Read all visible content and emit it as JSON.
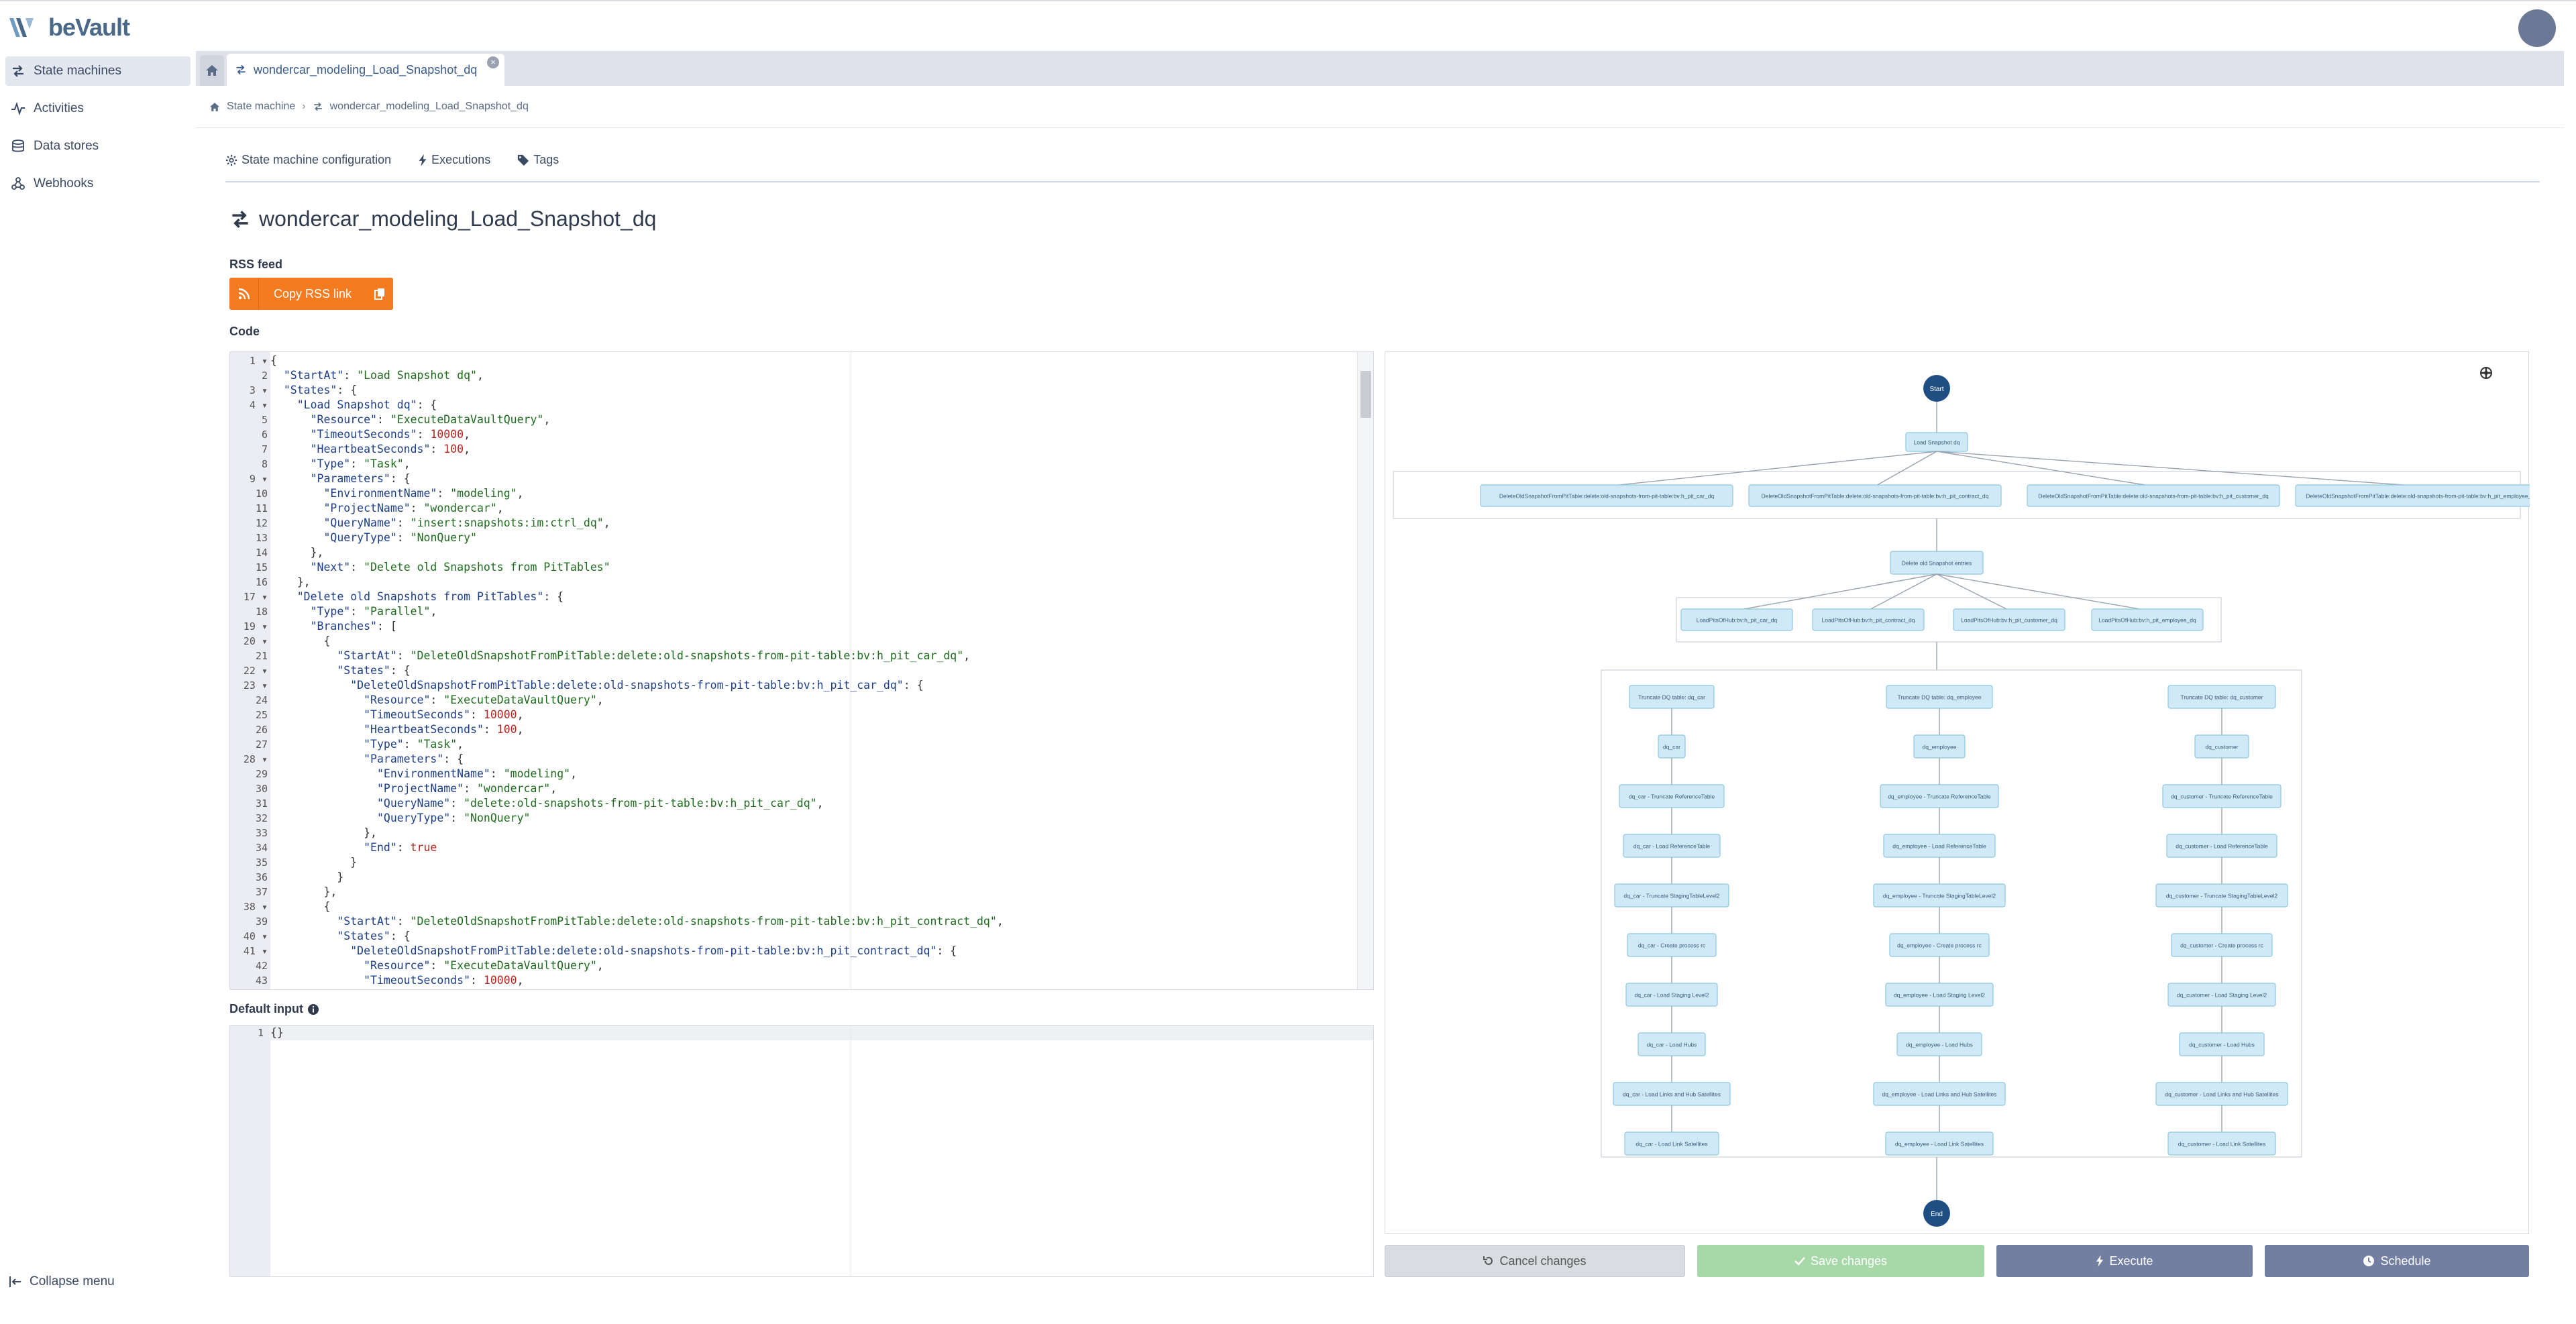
{
  "app": {
    "name": "beVault"
  },
  "sidebar": {
    "items": [
      {
        "label": "State machines",
        "icon": "exchange-icon",
        "active": true
      },
      {
        "label": "Activities",
        "icon": "activity-icon"
      },
      {
        "label": "Data stores",
        "icon": "database-icon"
      },
      {
        "label": "Webhooks",
        "icon": "webhook-icon"
      }
    ],
    "collapse_label": "Collapse menu"
  },
  "tabs": {
    "doc_tab_label": "wondercar_modeling_Load_Snapshot_dq"
  },
  "breadcrumb": {
    "root": "State machine",
    "current": "wondercar_modeling_Load_Snapshot_dq"
  },
  "page_tabs": {
    "config": "State machine configuration",
    "executions": "Executions",
    "tags": "Tags"
  },
  "page_title": "wondercar_modeling_Load_Snapshot_dq",
  "rss": {
    "label": "RSS feed",
    "button": "Copy RSS link"
  },
  "code_label": "Code",
  "default_input_label": "Default input",
  "default_input_value": "{}",
  "code_lines": [
    {
      "n": "1",
      "f": true,
      "t": [
        [
          "p",
          "{"
        ]
      ]
    },
    {
      "n": "2",
      "t": [
        [
          "p",
          "  "
        ],
        [
          "k",
          "\"StartAt\""
        ],
        [
          "p",
          ": "
        ],
        [
          "s",
          "\"Load Snapshot dq\""
        ],
        [
          "p",
          ","
        ]
      ]
    },
    {
      "n": "3",
      "f": true,
      "t": [
        [
          "p",
          "  "
        ],
        [
          "k",
          "\"States\""
        ],
        [
          "p",
          ": {"
        ]
      ]
    },
    {
      "n": "4",
      "f": true,
      "t": [
        [
          "p",
          "    "
        ],
        [
          "k",
          "\"Load Snapshot dq\""
        ],
        [
          "p",
          ": {"
        ]
      ]
    },
    {
      "n": "5",
      "t": [
        [
          "p",
          "      "
        ],
        [
          "k",
          "\"Resource\""
        ],
        [
          "p",
          ": "
        ],
        [
          "s",
          "\"ExecuteDataVaultQuery\""
        ],
        [
          "p",
          ","
        ]
      ]
    },
    {
      "n": "6",
      "t": [
        [
          "p",
          "      "
        ],
        [
          "k",
          "\"TimeoutSeconds\""
        ],
        [
          "p",
          ": "
        ],
        [
          "n",
          "10000"
        ],
        [
          "p",
          ","
        ]
      ]
    },
    {
      "n": "7",
      "t": [
        [
          "p",
          "      "
        ],
        [
          "k",
          "\"HeartbeatSeconds\""
        ],
        [
          "p",
          ": "
        ],
        [
          "n",
          "100"
        ],
        [
          "p",
          ","
        ]
      ]
    },
    {
      "n": "8",
      "t": [
        [
          "p",
          "      "
        ],
        [
          "k",
          "\"Type\""
        ],
        [
          "p",
          ": "
        ],
        [
          "s",
          "\"Task\""
        ],
        [
          "p",
          ","
        ]
      ]
    },
    {
      "n": "9",
      "f": true,
      "t": [
        [
          "p",
          "      "
        ],
        [
          "k",
          "\"Parameters\""
        ],
        [
          "p",
          ": {"
        ]
      ]
    },
    {
      "n": "10",
      "t": [
        [
          "p",
          "        "
        ],
        [
          "k",
          "\"EnvironmentName\""
        ],
        [
          "p",
          ": "
        ],
        [
          "s",
          "\"modeling\""
        ],
        [
          "p",
          ","
        ]
      ]
    },
    {
      "n": "11",
      "t": [
        [
          "p",
          "        "
        ],
        [
          "k",
          "\"ProjectName\""
        ],
        [
          "p",
          ": "
        ],
        [
          "s",
          "\"wondercar\""
        ],
        [
          "p",
          ","
        ]
      ]
    },
    {
      "n": "12",
      "t": [
        [
          "p",
          "        "
        ],
        [
          "k",
          "\"QueryName\""
        ],
        [
          "p",
          ": "
        ],
        [
          "s",
          "\"insert:snapshots:im:ctrl_dq\""
        ],
        [
          "p",
          ","
        ]
      ]
    },
    {
      "n": "13",
      "t": [
        [
          "p",
          "        "
        ],
        [
          "k",
          "\"QueryType\""
        ],
        [
          "p",
          ": "
        ],
        [
          "s",
          "\"NonQuery\""
        ]
      ]
    },
    {
      "n": "14",
      "t": [
        [
          "p",
          "      },"
        ]
      ]
    },
    {
      "n": "15",
      "t": [
        [
          "p",
          "      "
        ],
        [
          "k",
          "\"Next\""
        ],
        [
          "p",
          ": "
        ],
        [
          "s",
          "\"Delete old Snapshots from PitTables\""
        ]
      ]
    },
    {
      "n": "16",
      "t": [
        [
          "p",
          "    },"
        ]
      ]
    },
    {
      "n": "17",
      "f": true,
      "t": [
        [
          "p",
          "    "
        ],
        [
          "k",
          "\"Delete old Snapshots from PitTables\""
        ],
        [
          "p",
          ": {"
        ]
      ]
    },
    {
      "n": "18",
      "t": [
        [
          "p",
          "      "
        ],
        [
          "k",
          "\"Type\""
        ],
        [
          "p",
          ": "
        ],
        [
          "s",
          "\"Parallel\""
        ],
        [
          "p",
          ","
        ]
      ]
    },
    {
      "n": "19",
      "f": true,
      "t": [
        [
          "p",
          "      "
        ],
        [
          "k",
          "\"Branches\""
        ],
        [
          "p",
          ": ["
        ]
      ]
    },
    {
      "n": "20",
      "f": true,
      "t": [
        [
          "p",
          "        {"
        ]
      ]
    },
    {
      "n": "21",
      "t": [
        [
          "p",
          "          "
        ],
        [
          "k",
          "\"StartAt\""
        ],
        [
          "p",
          ": "
        ],
        [
          "s",
          "\"DeleteOldSnapshotFromPitTable:delete:old-snapshots-from-pit-table:bv:h_pit_car_dq\""
        ],
        [
          "p",
          ","
        ]
      ]
    },
    {
      "n": "22",
      "f": true,
      "t": [
        [
          "p",
          "          "
        ],
        [
          "k",
          "\"States\""
        ],
        [
          "p",
          ": {"
        ]
      ]
    },
    {
      "n": "23",
      "f": true,
      "t": [
        [
          "p",
          "            "
        ],
        [
          "k",
          "\"DeleteOldSnapshotFromPitTable:delete:old-snapshots-from-pit-table:bv:h_pit_car_dq\""
        ],
        [
          "p",
          ": {"
        ]
      ]
    },
    {
      "n": "24",
      "t": [
        [
          "p",
          "              "
        ],
        [
          "k",
          "\"Resource\""
        ],
        [
          "p",
          ": "
        ],
        [
          "s",
          "\"ExecuteDataVaultQuery\""
        ],
        [
          "p",
          ","
        ]
      ]
    },
    {
      "n": "25",
      "t": [
        [
          "p",
          "              "
        ],
        [
          "k",
          "\"TimeoutSeconds\""
        ],
        [
          "p",
          ": "
        ],
        [
          "n",
          "10000"
        ],
        [
          "p",
          ","
        ]
      ]
    },
    {
      "n": "26",
      "t": [
        [
          "p",
          "              "
        ],
        [
          "k",
          "\"HeartbeatSeconds\""
        ],
        [
          "p",
          ": "
        ],
        [
          "n",
          "100"
        ],
        [
          "p",
          ","
        ]
      ]
    },
    {
      "n": "27",
      "t": [
        [
          "p",
          "              "
        ],
        [
          "k",
          "\"Type\""
        ],
        [
          "p",
          ": "
        ],
        [
          "s",
          "\"Task\""
        ],
        [
          "p",
          ","
        ]
      ]
    },
    {
      "n": "28",
      "f": true,
      "t": [
        [
          "p",
          "              "
        ],
        [
          "k",
          "\"Parameters\""
        ],
        [
          "p",
          ": {"
        ]
      ]
    },
    {
      "n": "29",
      "t": [
        [
          "p",
          "                "
        ],
        [
          "k",
          "\"EnvironmentName\""
        ],
        [
          "p",
          ": "
        ],
        [
          "s",
          "\"modeling\""
        ],
        [
          "p",
          ","
        ]
      ]
    },
    {
      "n": "30",
      "t": [
        [
          "p",
          "                "
        ],
        [
          "k",
          "\"ProjectName\""
        ],
        [
          "p",
          ": "
        ],
        [
          "s",
          "\"wondercar\""
        ],
        [
          "p",
          ","
        ]
      ]
    },
    {
      "n": "31",
      "t": [
        [
          "p",
          "                "
        ],
        [
          "k",
          "\"QueryName\""
        ],
        [
          "p",
          ": "
        ],
        [
          "s",
          "\"delete:old-snapshots-from-pit-table:bv:h_pit_car_dq\""
        ],
        [
          "p",
          ","
        ]
      ]
    },
    {
      "n": "32",
      "t": [
        [
          "p",
          "                "
        ],
        [
          "k",
          "\"QueryType\""
        ],
        [
          "p",
          ": "
        ],
        [
          "s",
          "\"NonQuery\""
        ]
      ]
    },
    {
      "n": "33",
      "t": [
        [
          "p",
          "              },"
        ]
      ]
    },
    {
      "n": "34",
      "t": [
        [
          "p",
          "              "
        ],
        [
          "k",
          "\"End\""
        ],
        [
          "p",
          ": "
        ],
        [
          "n",
          "true"
        ]
      ]
    },
    {
      "n": "35",
      "t": [
        [
          "p",
          "            }"
        ]
      ]
    },
    {
      "n": "36",
      "t": [
        [
          "p",
          "          }"
        ]
      ]
    },
    {
      "n": "37",
      "t": [
        [
          "p",
          "        },"
        ]
      ]
    },
    {
      "n": "38",
      "f": true,
      "t": [
        [
          "p",
          "        {"
        ]
      ]
    },
    {
      "n": "39",
      "t": [
        [
          "p",
          "          "
        ],
        [
          "k",
          "\"StartAt\""
        ],
        [
          "p",
          ": "
        ],
        [
          "s",
          "\"DeleteOldSnapshotFromPitTable:delete:old-snapshots-from-pit-table:bv:h_pit_contract_dq\""
        ],
        [
          "p",
          ","
        ]
      ]
    },
    {
      "n": "40",
      "f": true,
      "t": [
        [
          "p",
          "          "
        ],
        [
          "k",
          "\"States\""
        ],
        [
          "p",
          ": {"
        ]
      ]
    },
    {
      "n": "41",
      "f": true,
      "t": [
        [
          "p",
          "            "
        ],
        [
          "k",
          "\"DeleteOldSnapshotFromPitTable:delete:old-snapshots-from-pit-table:bv:h_pit_contract_dq\""
        ],
        [
          "p",
          ": {"
        ]
      ]
    },
    {
      "n": "42",
      "t": [
        [
          "p",
          "              "
        ],
        [
          "k",
          "\"Resource\""
        ],
        [
          "p",
          ": "
        ],
        [
          "s",
          "\"ExecuteDataVaultQuery\""
        ],
        [
          "p",
          ","
        ]
      ]
    },
    {
      "n": "43",
      "t": [
        [
          "p",
          "              "
        ],
        [
          "k",
          "\"TimeoutSeconds\""
        ],
        [
          "p",
          ": "
        ],
        [
          "n",
          "10000"
        ],
        [
          "p",
          ","
        ]
      ]
    }
  ],
  "graph": {
    "start": "Start",
    "end": "End",
    "load_snapshot": "Load Snapshot dq",
    "delete_branches": [
      "DeleteOldSnapshotFromPitTable:delete:old-snapshots-from-pit-table:bv:h_pit_car_dq",
      "DeleteOldSnapshotFromPitTable:delete:old-snapshots-from-pit-table:bv:h_pit_contract_dq",
      "DeleteOldSnapshotFromPitTable:delete:old-snapshots-from-pit-table:bv:h_pit_customer_dq",
      "DeleteOldSnapshotFromPitTable:delete:old-snapshots-from-pit-table:bv:h_pit_employee_dq"
    ],
    "delete_old_snapshot_entries": "Delete old Snapshot entries",
    "loadpit_branches": [
      "LoadPitsOfHub:bv:h_pit_car_dq",
      "LoadPitsOfHub:bv:h_pit_contract_dq",
      "LoadPitsOfHub:bv:h_pit_customer_dq",
      "LoadPitsOfHub:bv:h_pit_employee_dq"
    ],
    "dq_columns": [
      [
        "Truncate DQ table: dq_car",
        "dq_car",
        "dq_car - Truncate ReferenceTable",
        "dq_car - Load ReferenceTable",
        "dq_car - Truncate StagingTableLevel2",
        "dq_car - Create process rc",
        "dq_car - Load Staging Level2",
        "dq_car - Load Hubs",
        "dq_car - Load Links and Hub Satellites",
        "dq_car - Load Link Satellites"
      ],
      [
        "Truncate DQ table: dq_employee",
        "dq_employee",
        "dq_employee - Truncate ReferenceTable",
        "dq_employee - Load ReferenceTable",
        "dq_employee - Truncate StagingTableLevel2",
        "dq_employee - Create process rc",
        "dq_employee - Load Staging Level2",
        "dq_employee - Load Hubs",
        "dq_employee - Load Links and Hub Satellites",
        "dq_employee - Load Link Satellites"
      ],
      [
        "Truncate DQ table: dq_customer",
        "dq_customer",
        "dq_customer - Truncate ReferenceTable",
        "dq_customer - Load ReferenceTable",
        "dq_customer - Truncate StagingTableLevel2",
        "dq_customer - Create process rc",
        "dq_customer - Load Staging Level2",
        "dq_customer - Load Hubs",
        "dq_customer - Load Links and Hub Satellites",
        "dq_customer - Load Link Satellites"
      ]
    ]
  },
  "buttons": {
    "cancel": "Cancel changes",
    "save": "Save changes",
    "execute": "Execute",
    "schedule": "Schedule"
  },
  "colors": {
    "accent": "#f47b20",
    "node_fill": "#cfe9f6",
    "node_stroke": "#8fc7e0",
    "start_end": "#1f4f82",
    "button_primary": "#737fa1",
    "button_save": "#a7d9a8"
  }
}
